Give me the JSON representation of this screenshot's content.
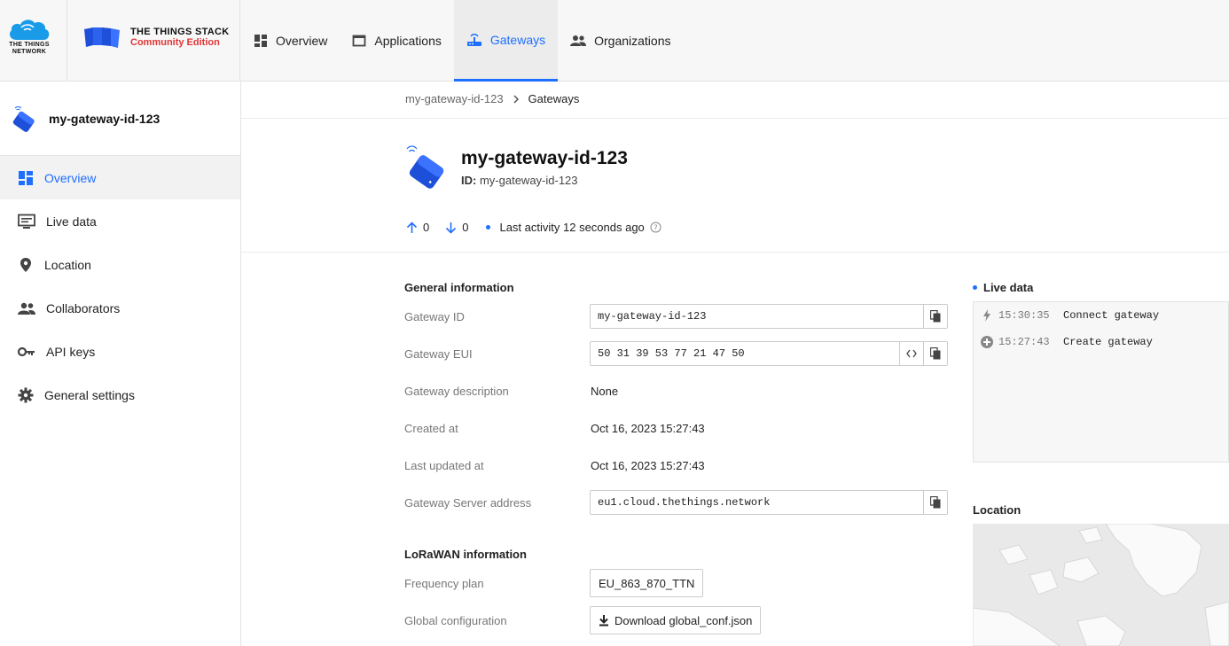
{
  "brand": {
    "ttn_line1": "THE THINGS",
    "ttn_line2": "NETWORK",
    "stack_title": "THE THINGS STACK",
    "stack_edition": "Community Edition"
  },
  "nav": [
    {
      "label": "Overview",
      "icon": "dashboard-icon"
    },
    {
      "label": "Applications",
      "icon": "window-icon"
    },
    {
      "label": "Gateways",
      "icon": "router-icon",
      "active": true
    },
    {
      "label": "Organizations",
      "icon": "people-icon"
    }
  ],
  "sidebar": {
    "gateway_name": "my-gateway-id-123",
    "items": [
      {
        "label": "Overview",
        "icon": "dashboard-icon",
        "active": true
      },
      {
        "label": "Live data",
        "icon": "live-data-icon"
      },
      {
        "label": "Location",
        "icon": "location-pin-icon"
      },
      {
        "label": "Collaborators",
        "icon": "people-icon"
      },
      {
        "label": "API keys",
        "icon": "key-icon"
      },
      {
        "label": "General settings",
        "icon": "gear-icon"
      }
    ]
  },
  "breadcrumb": {
    "parent": "my-gateway-id-123",
    "current": "Gateways"
  },
  "header": {
    "title": "my-gateway-id-123",
    "id_label": "ID:",
    "id_value": "my-gateway-id-123",
    "uplink_count": "0",
    "downlink_count": "0",
    "last_activity": "Last activity 12 seconds ago"
  },
  "general": {
    "title": "General information",
    "gateway_id_label": "Gateway ID",
    "gateway_id": "my-gateway-id-123",
    "gateway_eui_label": "Gateway EUI",
    "gateway_eui": "50 31 39 53 77 21 47 50",
    "description_label": "Gateway description",
    "description": "None",
    "created_label": "Created at",
    "created": "Oct 16, 2023 15:27:43",
    "updated_label": "Last updated at",
    "updated": "Oct 16, 2023 15:27:43",
    "server_label": "Gateway Server address",
    "server": "eu1.cloud.thethings.network"
  },
  "lorawan": {
    "title": "LoRaWAN information",
    "frequency_label": "Frequency plan",
    "frequency": "EU_863_870_TTN",
    "global_conf_label": "Global configuration",
    "download_button": "Download global_conf.json"
  },
  "live_data": {
    "title": "Live data",
    "events": [
      {
        "time": "15:30:35",
        "message": "Connect gateway",
        "icon": "bolt-icon"
      },
      {
        "time": "15:27:43",
        "message": "Create gateway",
        "icon": "add-circle-icon"
      }
    ]
  },
  "location": {
    "title": "Location"
  },
  "colors": {
    "accent": "#1e6fff",
    "brand_red": "#e03535"
  }
}
